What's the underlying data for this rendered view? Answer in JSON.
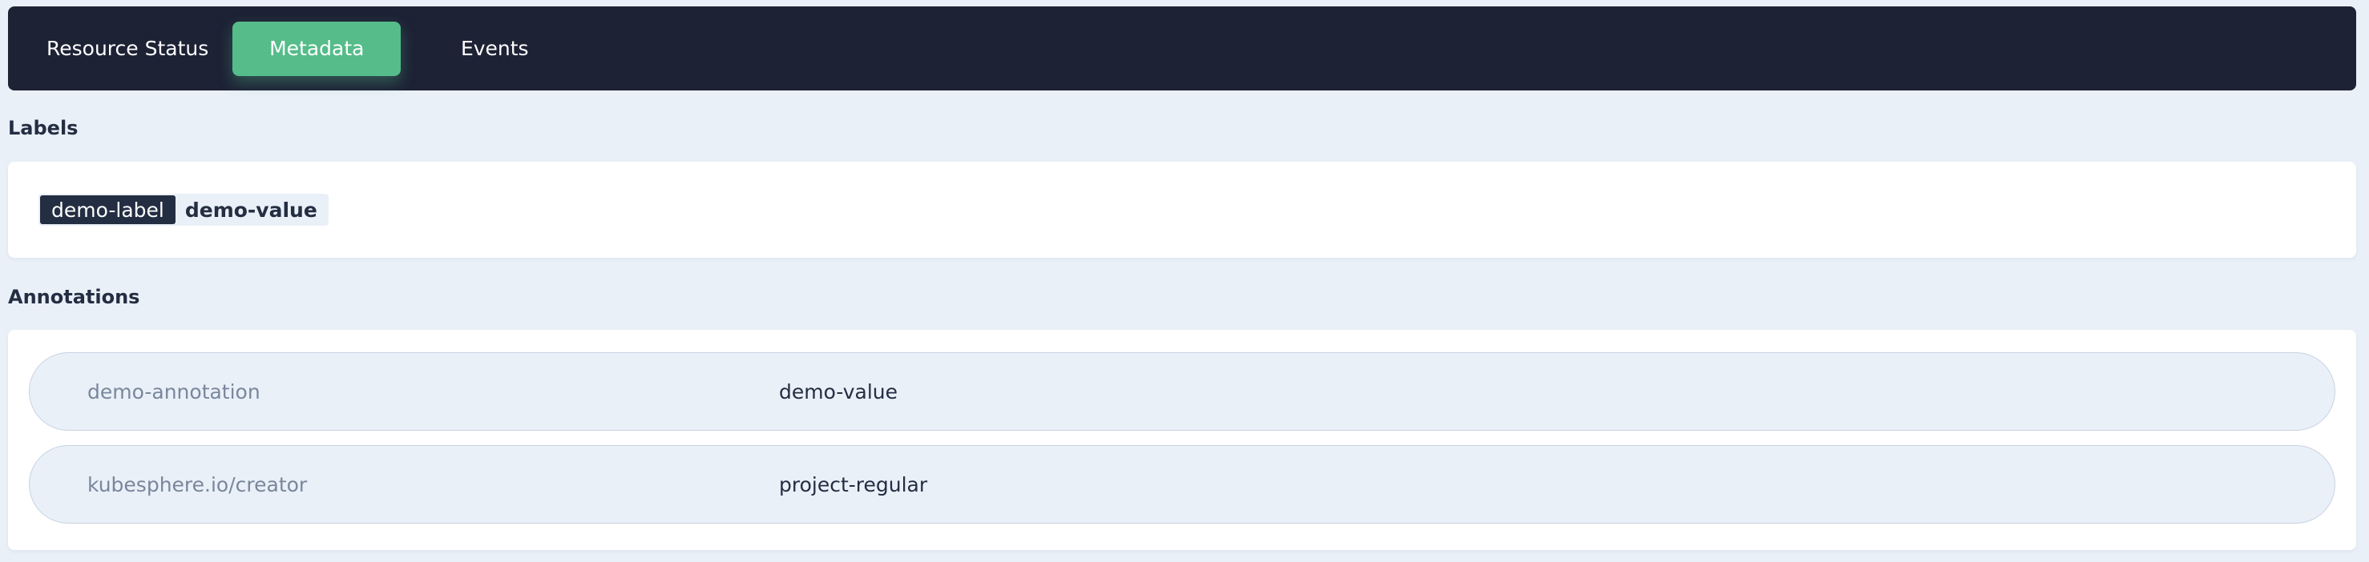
{
  "tabs": [
    {
      "label": "Resource Status",
      "active": false
    },
    {
      "label": "Metadata",
      "active": true
    },
    {
      "label": "Events",
      "active": false
    }
  ],
  "labels": {
    "title": "Labels",
    "items": [
      {
        "key": "demo-label",
        "value": "demo-value"
      }
    ]
  },
  "annotations": {
    "title": "Annotations",
    "items": [
      {
        "key": "demo-annotation",
        "value": "demo-value"
      },
      {
        "key": "kubesphere.io/creator",
        "value": "project-regular"
      }
    ]
  },
  "colors": {
    "background": "#eaf0f8",
    "tabbar": "#1d2235",
    "active_tab": "#55bc8a",
    "text_dark": "#242e42",
    "text_muted": "#79879c"
  }
}
